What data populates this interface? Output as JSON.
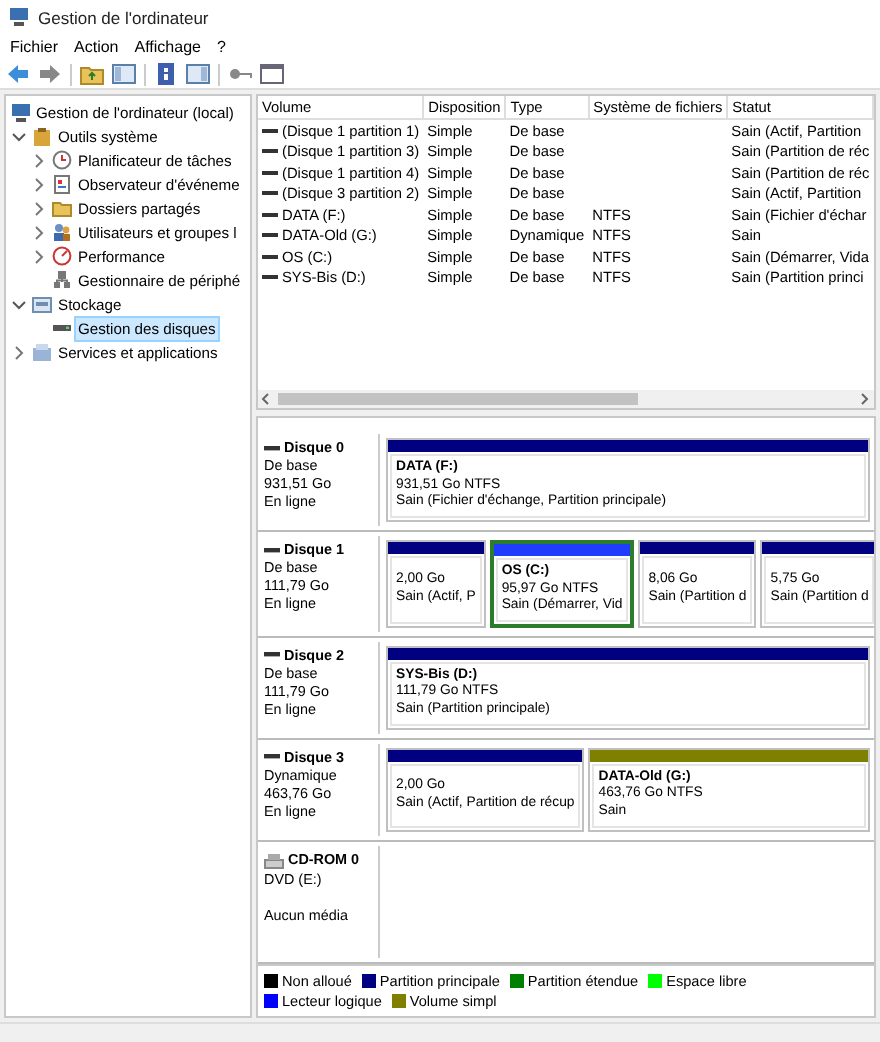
{
  "window": {
    "title": "Gestion de l'ordinateur"
  },
  "menu": [
    "Fichier",
    "Action",
    "Affichage",
    "?"
  ],
  "tree": {
    "items": [
      {
        "label": "Gestion de l'ordinateur (local)",
        "selected": false,
        "children": [
          {
            "label": "Outils système",
            "selected": false,
            "expanded": true,
            "children": [
              {
                "label": "Planificateur de tâches",
                "selected": false,
                "expanded": false
              },
              {
                "label": "Observateur d'événeme",
                "selected": false,
                "expanded": false
              },
              {
                "label": "Dossiers partagés",
                "selected": false,
                "expanded": false
              },
              {
                "label": "Utilisateurs et groupes l",
                "selected": false,
                "expanded": false
              },
              {
                "label": "Performance",
                "selected": false,
                "expanded": false
              },
              {
                "label": "Gestionnaire de périphé",
                "selected": false
              }
            ]
          },
          {
            "label": "Stockage",
            "selected": false,
            "expanded": true,
            "children": [
              {
                "label": "Gestion des disques",
                "selected": true
              }
            ]
          },
          {
            "label": "Services et applications",
            "selected": false,
            "expanded": false
          }
        ]
      }
    ]
  },
  "volume_table": {
    "columns": [
      "Volume",
      "Disposition",
      "Type",
      "Système de fichiers",
      "Statut"
    ],
    "rows": [
      {
        "volume": "(Disque 1 partition 1)",
        "layout": "Simple",
        "type": "De base",
        "status": "Sain (Actif, Partition"
      },
      {
        "volume": "(Disque 1 partition 3)",
        "layout": "Simple",
        "type": "De base",
        "status": "Sain (Partition de réc"
      },
      {
        "volume": "(Disque 1 partition 4)",
        "layout": "Simple",
        "type": "De base",
        "status": "Sain (Partition de réc"
      },
      {
        "volume": "(Disque 3 partition 2)",
        "layout": "Simple",
        "type": "De base",
        "status": "Sain (Actif, Partition"
      },
      {
        "volume": "DATA (F:)",
        "layout": "Simple",
        "type": "De base",
        "file_system": "NTFS",
        "status": "Sain (Fichier d'échar"
      },
      {
        "volume": "DATA-Old (G:)",
        "layout": "Simple",
        "type": "Dynamique",
        "file_system": "NTFS",
        "status": "Sain"
      },
      {
        "volume": "OS (C:)",
        "layout": "Simple",
        "type": "De base",
        "file_system": "NTFS",
        "status": "Sain (Démarrer, Vida"
      },
      {
        "volume": "SYS-Bis (D:)",
        "layout": "Simple",
        "type": "De base",
        "file_system": "NTFS",
        "status": "Sain (Partition princi"
      }
    ]
  },
  "disks": [
    {
      "kind": "disk",
      "name": "Disque 0",
      "details": [
        "De base",
        "931,51 Go",
        "En ligne"
      ],
      "partitions": [
        {
          "title": "DATA  (F:)",
          "size": "931,51 Go NTFS",
          "status": "Sain (Fichier d'échange, Partition principale)",
          "color": "#000080",
          "selected": false
        }
      ]
    },
    {
      "kind": "disk",
      "name": "Disque 1",
      "details": [
        "De base",
        "111,79 Go",
        "En ligne"
      ],
      "partitions": [
        {
          "size": "2,00 Go",
          "status": "Sain (Actif, P",
          "color": "#000080",
          "selected": false
        },
        {
          "title": "OS  (C:)",
          "size": "95,97 Go NTFS",
          "status": "Sain (Démarrer, Vid",
          "color": "#1f3dff",
          "selected": true
        },
        {
          "size": "8,06 Go",
          "status": "Sain (Partition d",
          "color": "#000080",
          "selected": false
        },
        {
          "size": "5,75 Go",
          "status": "Sain (Partition d",
          "color": "#000080",
          "selected": false
        }
      ]
    },
    {
      "kind": "disk",
      "name": "Disque 2",
      "details": [
        "De base",
        "111,79 Go",
        "En ligne"
      ],
      "partitions": [
        {
          "title": "SYS-Bis  (D:)",
          "size": "111,79 Go NTFS",
          "status": "Sain (Partition principale)",
          "color": "#000080",
          "selected": false
        }
      ]
    },
    {
      "kind": "disk",
      "name": "Disque 3",
      "details": [
        "Dynamique",
        "463,76 Go",
        "En ligne"
      ],
      "partitions": [
        {
          "size": "2,00 Go",
          "status": "Sain (Actif, Partition de récup",
          "color": "#000080",
          "selected": false
        },
        {
          "title": "DATA-Old  (G:)",
          "size": "463,76 Go NTFS",
          "status": "Sain",
          "color": "#808000",
          "selected": false
        }
      ]
    },
    {
      "kind": "cdrom",
      "name": "CD-ROM 0",
      "details": [
        "DVD (E:)",
        "Aucun média"
      ]
    }
  ],
  "legend": [
    {
      "label": "Non alloué",
      "color": "#000000"
    },
    {
      "label": "Partition principale",
      "color": "#000080"
    },
    {
      "label": "Partition étendue",
      "color": "#008000"
    },
    {
      "label": "Espace libre",
      "color": "#00ff00"
    },
    {
      "label": "Lecteur logique",
      "color": "#0000ff"
    },
    {
      "label": "Volume simpl",
      "color": "#808000"
    }
  ]
}
